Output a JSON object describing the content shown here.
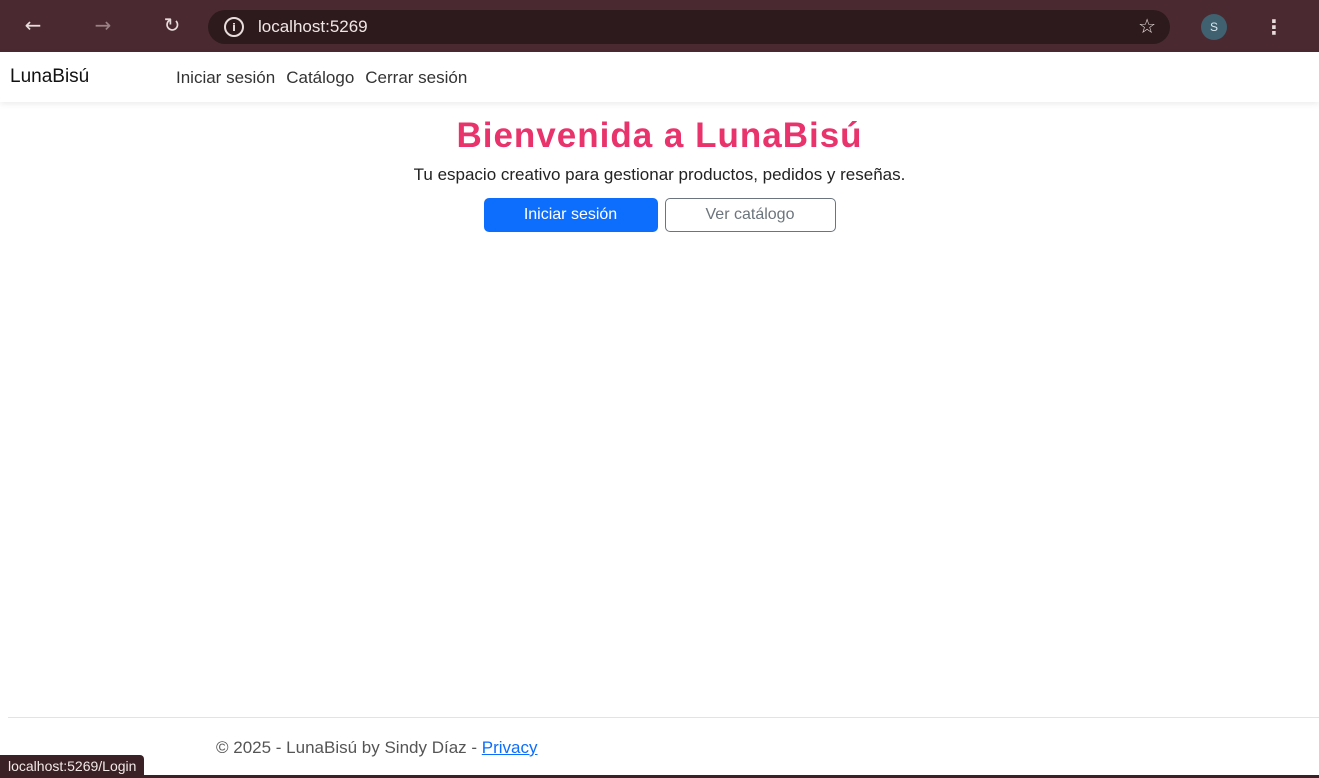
{
  "browser": {
    "url": "localhost:5269",
    "profile_initial": "S",
    "status_url": "localhost:5269/Login"
  },
  "navbar": {
    "brand": "LunaBisú",
    "links": [
      "Iniciar sesión",
      "Catálogo",
      "Cerrar sesión"
    ]
  },
  "hero": {
    "title": "Bienvenida a LunaBisú",
    "subtitle": "Tu espacio creativo para gestionar productos, pedidos y reseñas.",
    "primary_button": "Iniciar sesión",
    "secondary_button": "Ver catálogo"
  },
  "footer": {
    "text": "© 2025 - LunaBisú by Sindy Díaz - ",
    "privacy_link": "Privacy"
  },
  "colors": {
    "chrome": "#4a2a30",
    "title_accent": "#e8336d",
    "primary": "#0d6efd"
  },
  "icons": [
    "back-arrow-icon",
    "forward-arrow-icon",
    "reload-icon",
    "site-info-icon",
    "bookmark-star-icon",
    "kebab-menu-icon"
  ]
}
